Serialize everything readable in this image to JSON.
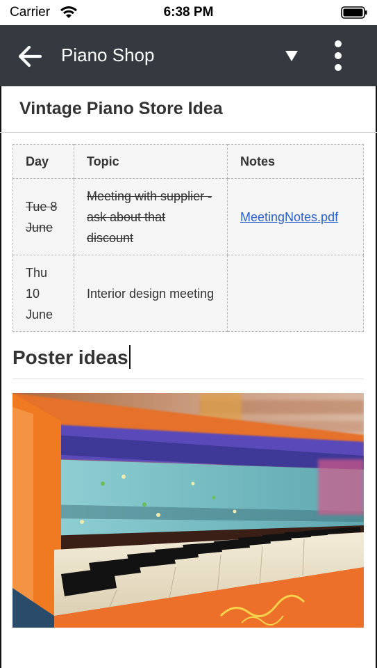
{
  "status_bar": {
    "carrier": "Carrier",
    "time": "6:38 PM"
  },
  "app_bar": {
    "title": "Piano Shop",
    "back_icon": "arrow-left-icon",
    "dropdown_icon": "caret-down-icon",
    "menu_icon": "more-vertical-icon",
    "background": "#343a40"
  },
  "document": {
    "title": "Vintage Piano Store Idea",
    "table": {
      "headers": [
        "Day",
        "Topic",
        "Notes"
      ],
      "rows": [
        {
          "day": "Tue 8 June",
          "topic": "Meeting with supplier - ask about that discount",
          "notes": "MeetingNotes.pdf",
          "completed": true
        },
        {
          "day": "Thu 10 June",
          "topic": "Interior design meeting",
          "notes": "",
          "completed": false
        }
      ]
    },
    "section_heading": "Poster ideas"
  },
  "colors": {
    "link": "#2a62c9",
    "table_bg": "#f5f5f5"
  }
}
